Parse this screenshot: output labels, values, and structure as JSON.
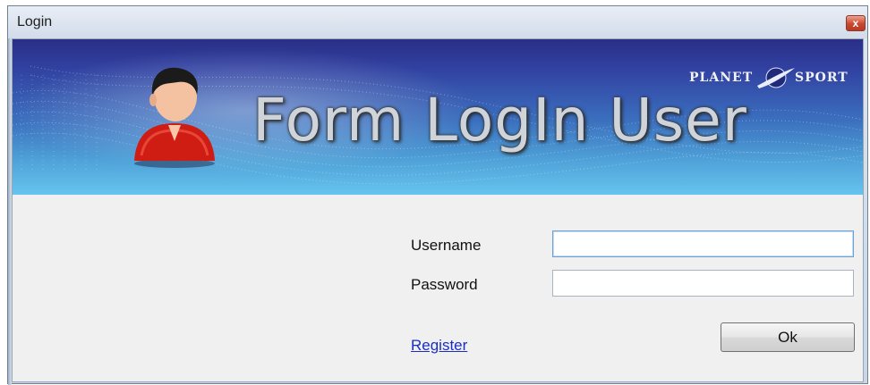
{
  "window": {
    "title": "Login",
    "close_symbol": "x"
  },
  "banner": {
    "title": "Form LogIn User",
    "brand_left": "PLANET",
    "brand_right": "SPORT",
    "avatar_icon": "user-avatar-icon",
    "brand_icon": "planet-swoosh-icon"
  },
  "form": {
    "username_label": "Username",
    "username_value": "",
    "password_label": "Password",
    "password_value": "",
    "register_link": "Register",
    "ok_button": "Ok"
  },
  "colors": {
    "banner_top": "#2a2f86",
    "banner_bottom": "#66c4ee",
    "link": "#1a2ec2",
    "close_button": "#c8482f"
  }
}
